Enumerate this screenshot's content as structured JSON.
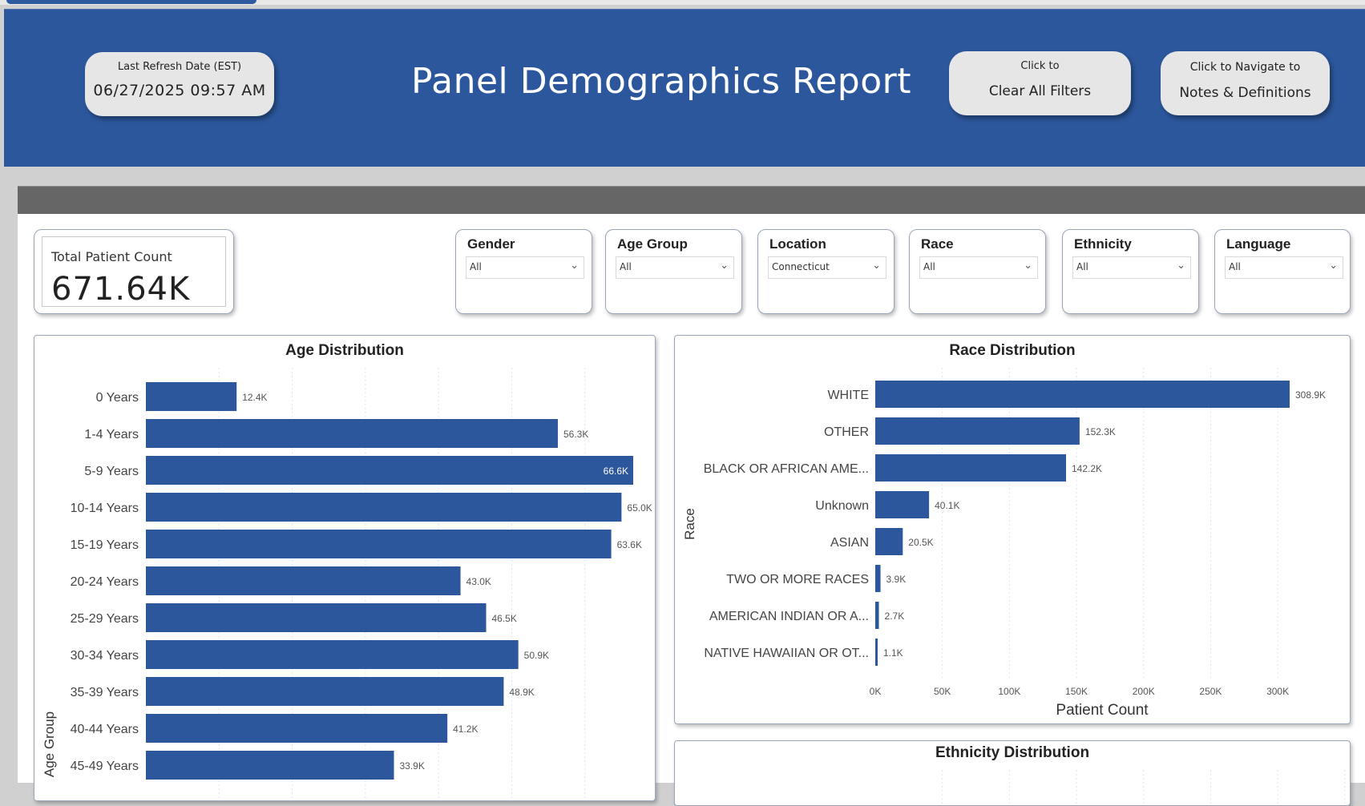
{
  "header": {
    "title": "Panel Demographics Report",
    "refresh_label": "Last Refresh Date (EST)",
    "refresh_value": "06/27/2025 09:57 AM",
    "clear_small": "Click to",
    "clear_label": "Clear All Filters",
    "notes_small": "Click to Navigate to",
    "notes_label": "Notes & Definitions"
  },
  "kpi": {
    "label": "Total Patient Count",
    "value": "671.64K"
  },
  "slicers": [
    {
      "title": "Gender",
      "value": "All"
    },
    {
      "title": "Age Group",
      "value": "All"
    },
    {
      "title": "Location",
      "value": "Connecticut"
    },
    {
      "title": "Race",
      "value": "All"
    },
    {
      "title": "Ethnicity",
      "value": "All"
    },
    {
      "title": "Language",
      "value": "All"
    }
  ],
  "icons": {
    "dropdown": "chevron-down-icon"
  },
  "colors": {
    "header": "#2c579c",
    "bar": "#2c579c"
  },
  "chart_data": [
    {
      "type": "bar",
      "orientation": "horizontal",
      "title": "Age Distribution",
      "ylabel": "Age Group",
      "xlabel": "",
      "categories": [
        "0 Years",
        "1-4 Years",
        "5-9 Years",
        "10-14 Years",
        "15-19 Years",
        "20-24 Years",
        "25-29 Years",
        "30-34 Years",
        "35-39 Years",
        "40-44 Years",
        "45-49 Years"
      ],
      "values": [
        12400,
        56300,
        66600,
        65000,
        63600,
        43000,
        46500,
        50900,
        48900,
        41200,
        33900
      ],
      "labels": [
        "12.4K",
        "56.3K",
        "66.6K",
        "65.0K",
        "63.6K",
        "43.0K",
        "46.5K",
        "50.9K",
        "48.9K",
        "41.2K",
        "33.9K"
      ],
      "xlim": [
        0,
        70000
      ],
      "grid": true
    },
    {
      "type": "bar",
      "orientation": "horizontal",
      "title": "Race Distribution",
      "ylabel": "Race",
      "xlabel": "Patient Count",
      "categories": [
        "WHITE",
        "OTHER",
        "BLACK OR AFRICAN AME...",
        "Unknown",
        "ASIAN",
        "TWO OR MORE RACES",
        "AMERICAN INDIAN OR A...",
        "NATIVE HAWAIIAN OR OT..."
      ],
      "values": [
        308900,
        152300,
        142200,
        40100,
        20500,
        3900,
        2700,
        1100
      ],
      "labels": [
        "308.9K",
        "152.3K",
        "142.2K",
        "40.1K",
        "20.5K",
        "3.9K",
        "2.7K",
        "1.1K"
      ],
      "ticks": [
        "0K",
        "50K",
        "100K",
        "150K",
        "200K",
        "250K",
        "300K"
      ],
      "xlim": [
        0,
        300000
      ],
      "grid": true
    },
    {
      "type": "bar",
      "title": "Ethnicity Distribution"
    }
  ]
}
